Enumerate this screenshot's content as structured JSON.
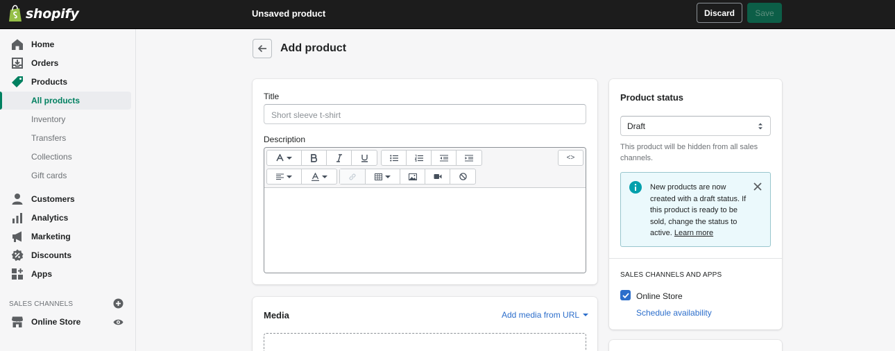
{
  "topbar": {
    "logo_text": "shopify",
    "title": "Unsaved product",
    "discard_label": "Discard",
    "save_label": "Save"
  },
  "sidebar": {
    "items": [
      {
        "label": "Home",
        "icon": "home-icon"
      },
      {
        "label": "Orders",
        "icon": "orders-icon"
      },
      {
        "label": "Products",
        "icon": "tag-icon"
      }
    ],
    "product_subitems": [
      "All products",
      "Inventory",
      "Transfers",
      "Collections",
      "Gift cards"
    ],
    "items2": [
      {
        "label": "Customers",
        "icon": "person-icon"
      },
      {
        "label": "Analytics",
        "icon": "bar-chart-icon"
      },
      {
        "label": "Marketing",
        "icon": "megaphone-icon"
      },
      {
        "label": "Discounts",
        "icon": "discount-icon"
      },
      {
        "label": "Apps",
        "icon": "apps-icon"
      }
    ],
    "sales_channels_label": "SALES CHANNELS",
    "online_store_label": "Online Store"
  },
  "page": {
    "title": "Add product"
  },
  "product_form": {
    "title_label": "Title",
    "title_placeholder": "Short sleeve t-shirt",
    "description_label": "Description",
    "code_button": "<>"
  },
  "media": {
    "title": "Media",
    "add_from_url": "Add media from URL"
  },
  "status_card": {
    "title": "Product status",
    "selected": "Draft",
    "help_text": "This product will be hidden from all sales channels.",
    "banner_text": "New products are now created with a draft status. If this product is ready to be sold, change the status to active.",
    "banner_link": "Learn more",
    "channels_label": "SALES CHANNELS AND APPS",
    "channel_name": "Online Store",
    "channel_checked": true,
    "schedule_link": "Schedule availability"
  },
  "colors": {
    "accent": "#008060",
    "link": "#2c6ecb",
    "topbar": "#1c1c1c"
  }
}
